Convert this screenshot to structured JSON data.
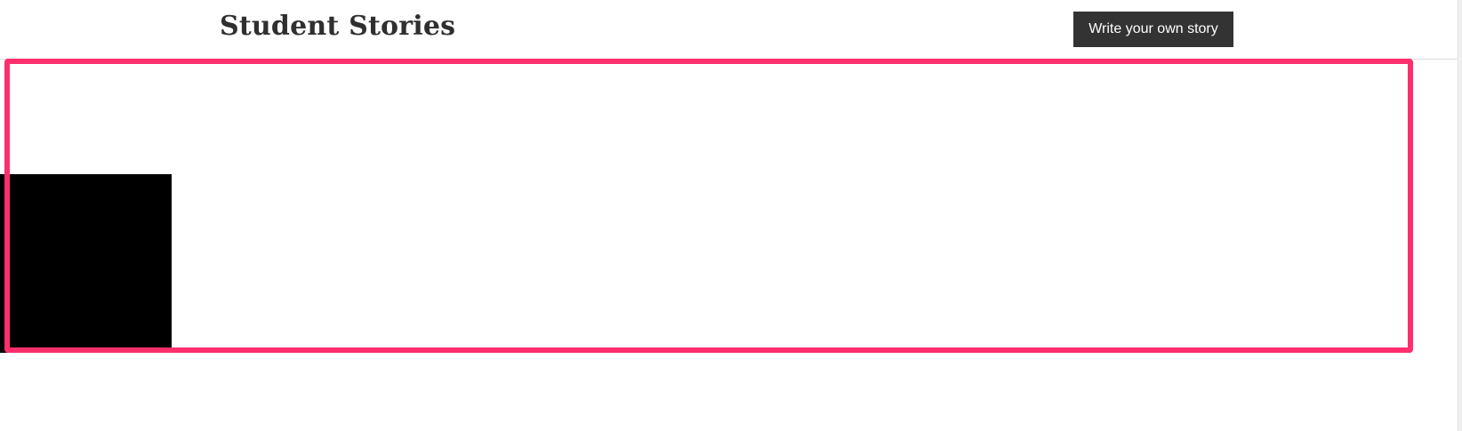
{
  "header": {
    "title": "Student Stories",
    "write_button_label": "Write your own story"
  },
  "colors": {
    "highlight": "#ff2f6d",
    "button_bg": "#333333",
    "title_text": "#2f2f2f"
  }
}
